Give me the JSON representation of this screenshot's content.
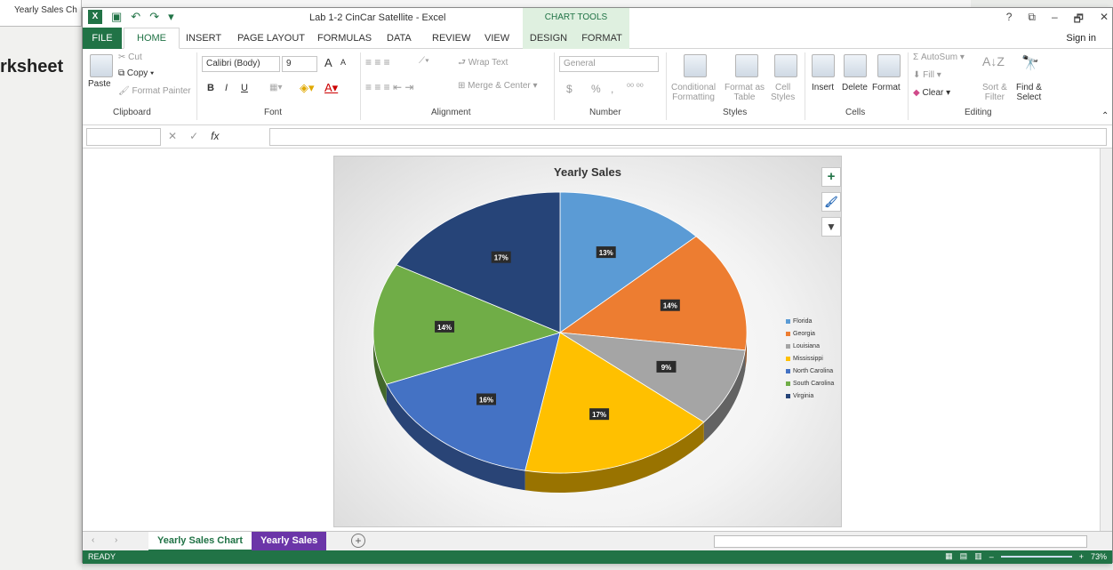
{
  "background": {
    "tab_label": "Yearly Sales Ch",
    "heading": "rksheet"
  },
  "window": {
    "title": "Lab 1-2 CinCar Satellite - Excel",
    "chart_tools_label": "CHART TOOLS",
    "sign_in": "Sign in",
    "controls": [
      "?",
      "⧉",
      "–",
      "🗗",
      "✕"
    ]
  },
  "tabs": [
    {
      "label": "FILE"
    },
    {
      "label": "HOME"
    },
    {
      "label": "INSERT"
    },
    {
      "label": "PAGE LAYOUT"
    },
    {
      "label": "FORMULAS"
    },
    {
      "label": "DATA"
    },
    {
      "label": "REVIEW"
    },
    {
      "label": "VIEW"
    },
    {
      "label": "DESIGN"
    },
    {
      "label": "FORMAT"
    }
  ],
  "ribbon": {
    "clipboard": {
      "paste": "Paste",
      "cut": "Cut",
      "copy": "Copy",
      "format_painter": "Format Painter",
      "label": "Clipboard"
    },
    "font": {
      "family": "Calibri (Body)",
      "size": "9",
      "label": "Font",
      "bold": "B",
      "italic": "I",
      "underline": "U",
      "grow": "A",
      "shrink": "A"
    },
    "alignment": {
      "wrap": "Wrap Text",
      "merge": "Merge & Center",
      "label": "Alignment"
    },
    "number": {
      "format": "General",
      "currency": "$",
      "percent": "%",
      "comma": ",",
      "label": "Number"
    },
    "styles": {
      "conditional": "Conditional",
      "conditional2": "Formatting",
      "format_as": "Format as",
      "format_as2": "Table",
      "cell": "Cell",
      "cell2": "Styles",
      "label": "Styles"
    },
    "cells": {
      "insert": "Insert",
      "delete": "Delete",
      "format": "Format",
      "label": "Cells"
    },
    "editing": {
      "autosum": "AutoSum",
      "fill": "Fill",
      "clear": "Clear",
      "sort": "Sort &",
      "sort2": "Filter",
      "find": "Find &",
      "find2": "Select",
      "label": "Editing"
    }
  },
  "formula_bar": {
    "fx": "fx"
  },
  "chart_data": {
    "type": "pie",
    "title": "Yearly Sales",
    "categories": [
      "Florida",
      "Georgia",
      "Louisiana",
      "Mississippi",
      "North Carolina",
      "South Carolina",
      "Virginia"
    ],
    "values": [
      13,
      14,
      9,
      17,
      16,
      14,
      17
    ],
    "data_labels": [
      "13%",
      "14%",
      "9%",
      "17%",
      "16%",
      "14%",
      "17%"
    ],
    "colors": [
      "#5b9bd5",
      "#ed7d31",
      "#a5a5a5",
      "#ffc000",
      "#4472c4",
      "#70ad47",
      "#264478"
    ],
    "legend_position": "right",
    "style": "3-D pie"
  },
  "sheet_tabs": [
    {
      "label": "Yearly Sales Chart"
    },
    {
      "label": "Yearly Sales"
    }
  ],
  "status": {
    "ready": "READY",
    "zoom": "73%"
  }
}
